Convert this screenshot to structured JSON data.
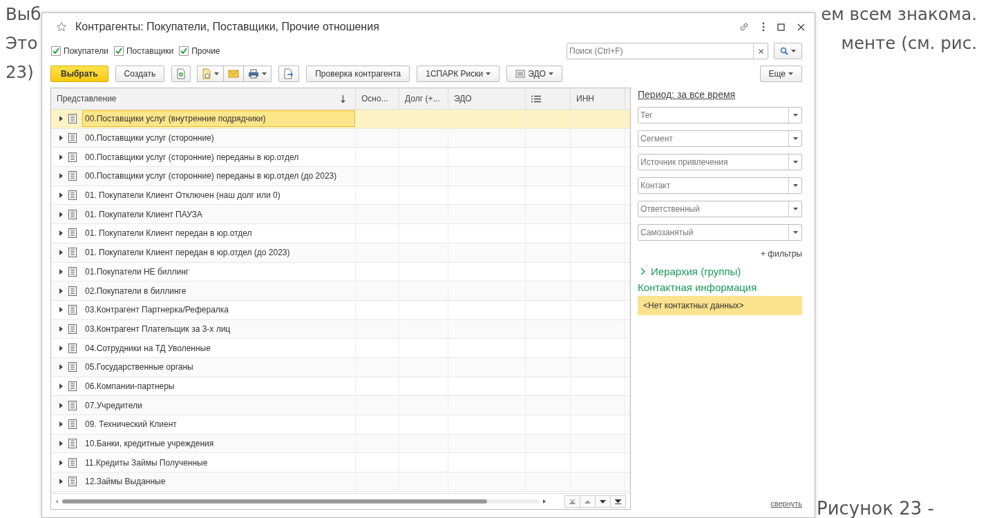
{
  "background_text": {
    "line_1_start": "Выб",
    "line_1_end": "ем всем знакома.",
    "line_2_start": "Это",
    "line_2_end": "менте (см. рис.",
    "line_3_start": "23)",
    "caption": "Рисунок 23 -"
  },
  "window": {
    "title": "Контрагенты: Покупатели, Поставщики, Прочие отношения"
  },
  "filters": [
    {
      "label": "Покупатели",
      "checked": true
    },
    {
      "label": "Поставщики",
      "checked": true
    },
    {
      "label": "Прочие",
      "checked": true
    }
  ],
  "search": {
    "placeholder": "Поиск (Ctrl+F)"
  },
  "toolbar": {
    "select": "Выбрать",
    "create": "Создать",
    "check": "Проверка контрагента",
    "spark": "1СПАРК Риски",
    "edo": "ЭДО",
    "more": "Еще"
  },
  "table": {
    "columns": [
      {
        "kind": "text",
        "label": "Представление",
        "sorted": true
      },
      {
        "kind": "text",
        "label": "Осно...",
        "sorted": false
      },
      {
        "kind": "text",
        "label": "Долг (+...",
        "sorted": false
      },
      {
        "kind": "text",
        "label": "ЭДО",
        "sorted": false
      },
      {
        "kind": "icon",
        "sorted": false
      },
      {
        "kind": "text",
        "label": "ИНН",
        "sorted": false
      }
    ],
    "rows": [
      {
        "name": "00.Поставщики услуг (внутренние подрядчики)",
        "selected": true
      },
      {
        "name": "00.Поставщики услуг (сторонние)",
        "selected": false
      },
      {
        "name": "00.Поставщики услуг (сторонние) переданы в юр.отдел",
        "selected": false
      },
      {
        "name": "00.Поставщики услуг (сторонние) переданы в юр.отдел (до 2023)",
        "selected": false
      },
      {
        "name": "01. Покупатели Клиент Отключен (наш долг или 0)",
        "selected": false
      },
      {
        "name": "01. Покупатели Клиент ПАУЗА",
        "selected": false
      },
      {
        "name": "01. Покупатели Клиент передан в юр.отдел",
        "selected": false
      },
      {
        "name": "01. Покупатели Клиент передан в юр.отдел (до 2023)",
        "selected": false
      },
      {
        "name": "01.Покупатели НЕ биллинг",
        "selected": false
      },
      {
        "name": "02.Покупатели в биллинге",
        "selected": false
      },
      {
        "name": "03.Контрагент Партнерка/Рефералка",
        "selected": false
      },
      {
        "name": "03.Контрагент Плательщик за 3-х лиц",
        "selected": false
      },
      {
        "name": "04.Сотрудники на ТД Уволенные",
        "selected": false
      },
      {
        "name": "05.Государственные органы",
        "selected": false
      },
      {
        "name": "06.Компании-партнеры",
        "selected": false
      },
      {
        "name": "07.Учредители",
        "selected": false
      },
      {
        "name": "09. Технический Клиент",
        "selected": false
      },
      {
        "name": "10.Банки, кредитные учреждения",
        "selected": false
      },
      {
        "name": "11.Кредиты Займы Полученные",
        "selected": false
      },
      {
        "name": "12.Займы Выданные",
        "selected": false
      }
    ]
  },
  "side_panel": {
    "period": "Период: за все время",
    "fields": [
      {
        "placeholder": "Тег"
      },
      {
        "placeholder": "Сегмент"
      },
      {
        "placeholder": "Источник привлечения"
      },
      {
        "placeholder": "Контакт"
      },
      {
        "placeholder": "Ответственный"
      },
      {
        "placeholder": "Самозанятый"
      }
    ],
    "more_filters": "+ фильтры",
    "hierarchy": {
      "label": "Иерархия (группы)",
      "expanded": false
    },
    "contact_title": "Контактная информация",
    "contact_value": "<Нет контактных данных>",
    "collapse": "свернуть"
  }
}
